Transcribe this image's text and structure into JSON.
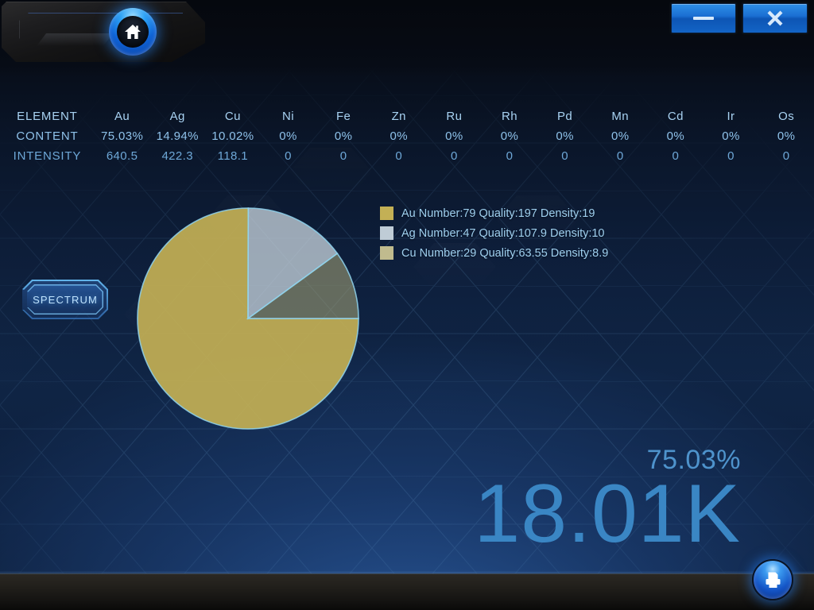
{
  "window": {
    "minimize_label": "—",
    "minimize_icon": "minimize-icon",
    "close_label": "✕",
    "close_icon": "close-icon",
    "home_icon": "home-icon",
    "print_icon": "printer-icon"
  },
  "buttons": {
    "spectrum_label": "SPECTRUM"
  },
  "table": {
    "row_labels": [
      "ELEMENT",
      "CONTENT",
      "INTENSITY"
    ],
    "elements": [
      "Au",
      "Ag",
      "Cu",
      "Ni",
      "Fe",
      "Zn",
      "Ru",
      "Rh",
      "Pd",
      "Mn",
      "Cd",
      "Ir",
      "Os"
    ],
    "content": [
      "75.03%",
      "14.94%",
      "10.02%",
      "0%",
      "0%",
      "0%",
      "0%",
      "0%",
      "0%",
      "0%",
      "0%",
      "0%",
      "0%"
    ],
    "intensity": [
      "640.5",
      "422.3",
      "118.1",
      "0",
      "0",
      "0",
      "0",
      "0",
      "0",
      "0",
      "0",
      "0",
      "0"
    ]
  },
  "legend": [
    {
      "label": "Au Number:79 Quality:197 Density:19",
      "color": "#c3b055"
    },
    {
      "label": "Ag Number:47 Quality:107.9 Density:10",
      "color": "#bfccd6"
    },
    {
      "label": "Cu Number:29 Quality:63.55 Density:8.9",
      "color": "#c0bb8e"
    }
  ],
  "readout": {
    "percent": "75.03%",
    "karat": "18.01K"
  },
  "colors": {
    "accent_blue": "#3a86c4",
    "text_blue": "#8fc2ea",
    "au": "#c3b055",
    "ag": "#bfccd6",
    "cu": "#9a9a72",
    "slice_border": "#8fd4ef",
    "background_deep": "#0d1d38"
  },
  "chart_data": {
    "type": "pie",
    "title": "",
    "labels": [
      "Au",
      "Ag",
      "Cu"
    ],
    "values": [
      75.03,
      14.94,
      10.02
    ],
    "colors": [
      "#c3b055",
      "#bfccd6",
      "#9a9a72"
    ],
    "unit": "%",
    "start_angle_deg": 0,
    "direction": "clockwise",
    "legend_position": "right",
    "grid": false,
    "annotations": [
      "Au Number:79 Quality:197 Density:19",
      "Ag Number:47 Quality:107.9 Density:10",
      "Cu Number:29 Quality:63.55 Density:8.9"
    ],
    "series_detail": [
      {
        "name": "Au",
        "value": 75.03,
        "intensity": 640.5,
        "number": 79,
        "quality": 197,
        "density": 19
      },
      {
        "name": "Ag",
        "value": 14.94,
        "intensity": 422.3,
        "number": 47,
        "quality": 107.9,
        "density": 10
      },
      {
        "name": "Cu",
        "value": 10.02,
        "intensity": 118.1,
        "number": 29,
        "quality": 63.55,
        "density": 8.9
      }
    ]
  }
}
